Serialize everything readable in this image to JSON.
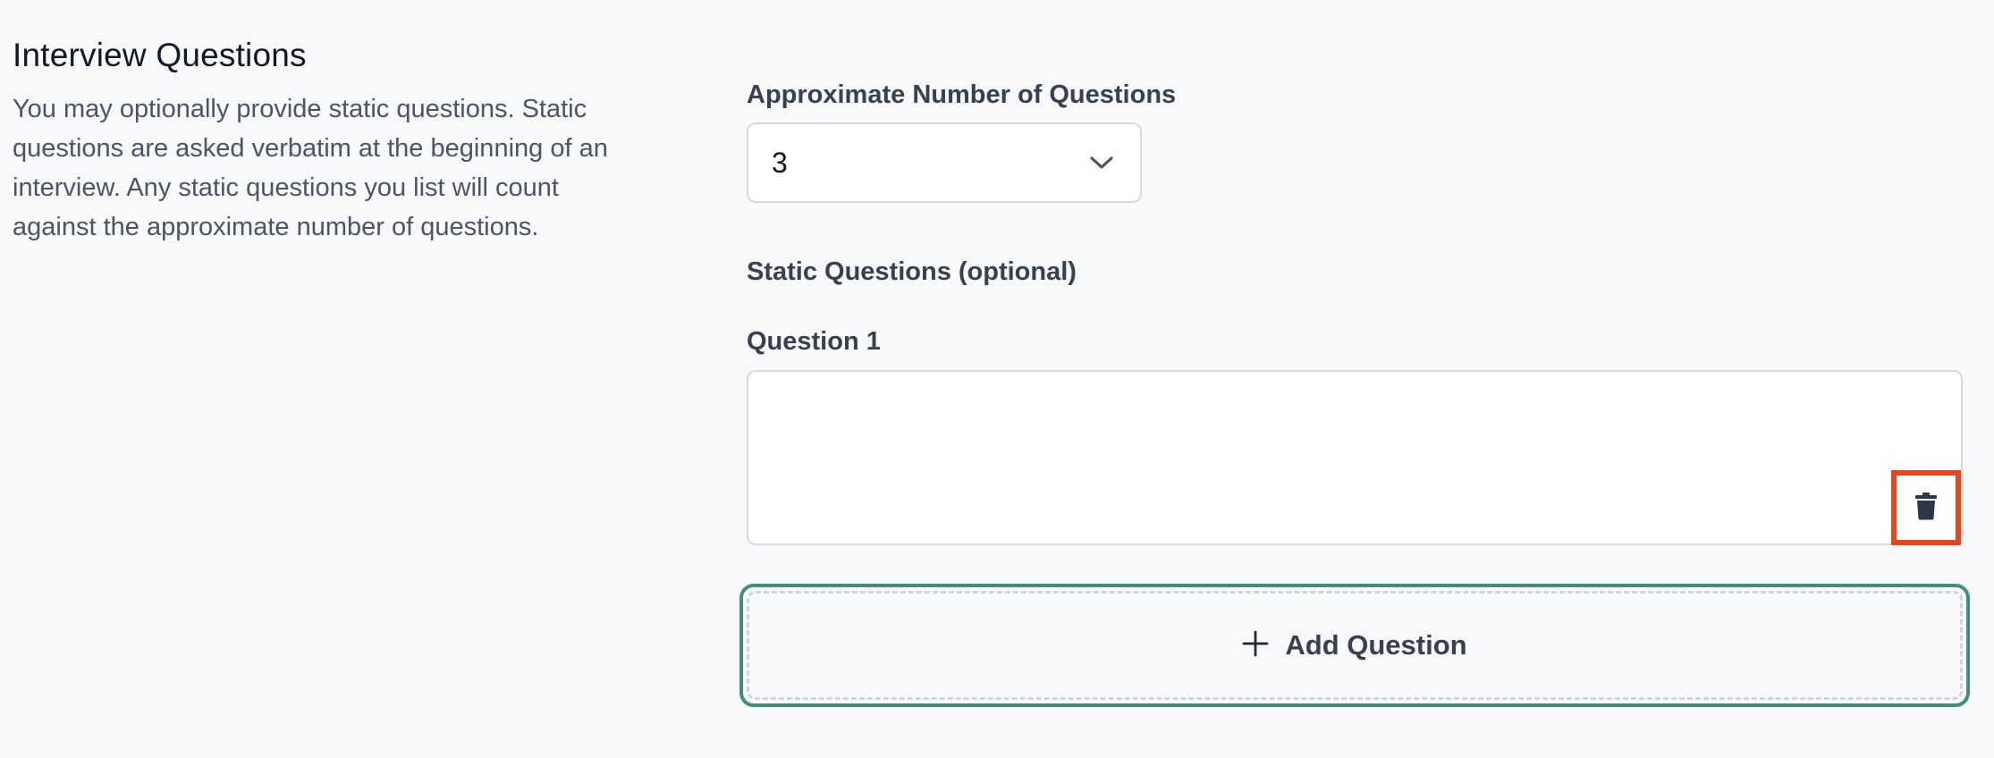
{
  "section": {
    "title": "Interview Questions",
    "description": "You may optionally provide static questions. Static questions are asked verbatim at the beginning of an interview. Any static questions you list will count against the approximate number of questions."
  },
  "approx_questions": {
    "label": "Approximate Number of Questions",
    "selected": "3",
    "icon": "chevron-down-icon"
  },
  "static_questions": {
    "label": "Static Questions (optional)",
    "questions": [
      {
        "label": "Question 1",
        "value": "",
        "delete_icon": "trash-icon"
      }
    ],
    "add_button_label": "Add Question",
    "add_icon": "plus-icon"
  },
  "colors": {
    "background": "#f8f9fb",
    "highlight_box": "#e8451f",
    "add_button_border": "#3f8f7a"
  }
}
